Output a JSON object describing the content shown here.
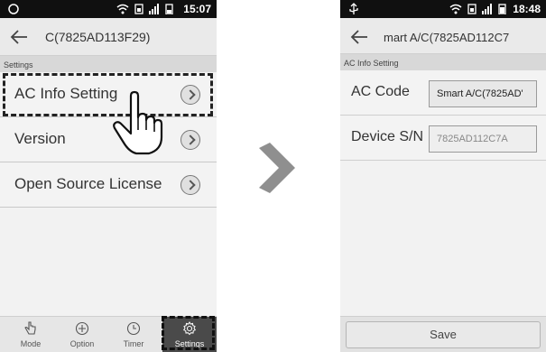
{
  "left_screen": {
    "status_time": "15:07",
    "title": "C(7825AD113F29)",
    "section": "Settings",
    "menu_items": [
      {
        "label": "AC Info Setting"
      },
      {
        "label": "Version"
      },
      {
        "label": "Open Source License"
      }
    ],
    "tabs": [
      {
        "label": "Mode",
        "icon": "hand-pointer-icon"
      },
      {
        "label": "Option",
        "icon": "plus-circle-icon"
      },
      {
        "label": "Timer",
        "icon": "clock-icon"
      },
      {
        "label": "Settings",
        "icon": "gear-icon"
      }
    ]
  },
  "right_screen": {
    "status_time": "18:48",
    "title": "mart A/C(7825AD112C7",
    "section": "AC Info Setting",
    "fields": [
      {
        "label": "AC Code",
        "value": "Smart A/C(7825AD'"
      },
      {
        "label": "Device S/N",
        "value": "7825AD112C7A"
      }
    ],
    "save_label": "Save"
  },
  "colors": {
    "statusbar": "#101010",
    "arrow": "#8f8f8f",
    "selected_tab": "#4a4a4a"
  }
}
